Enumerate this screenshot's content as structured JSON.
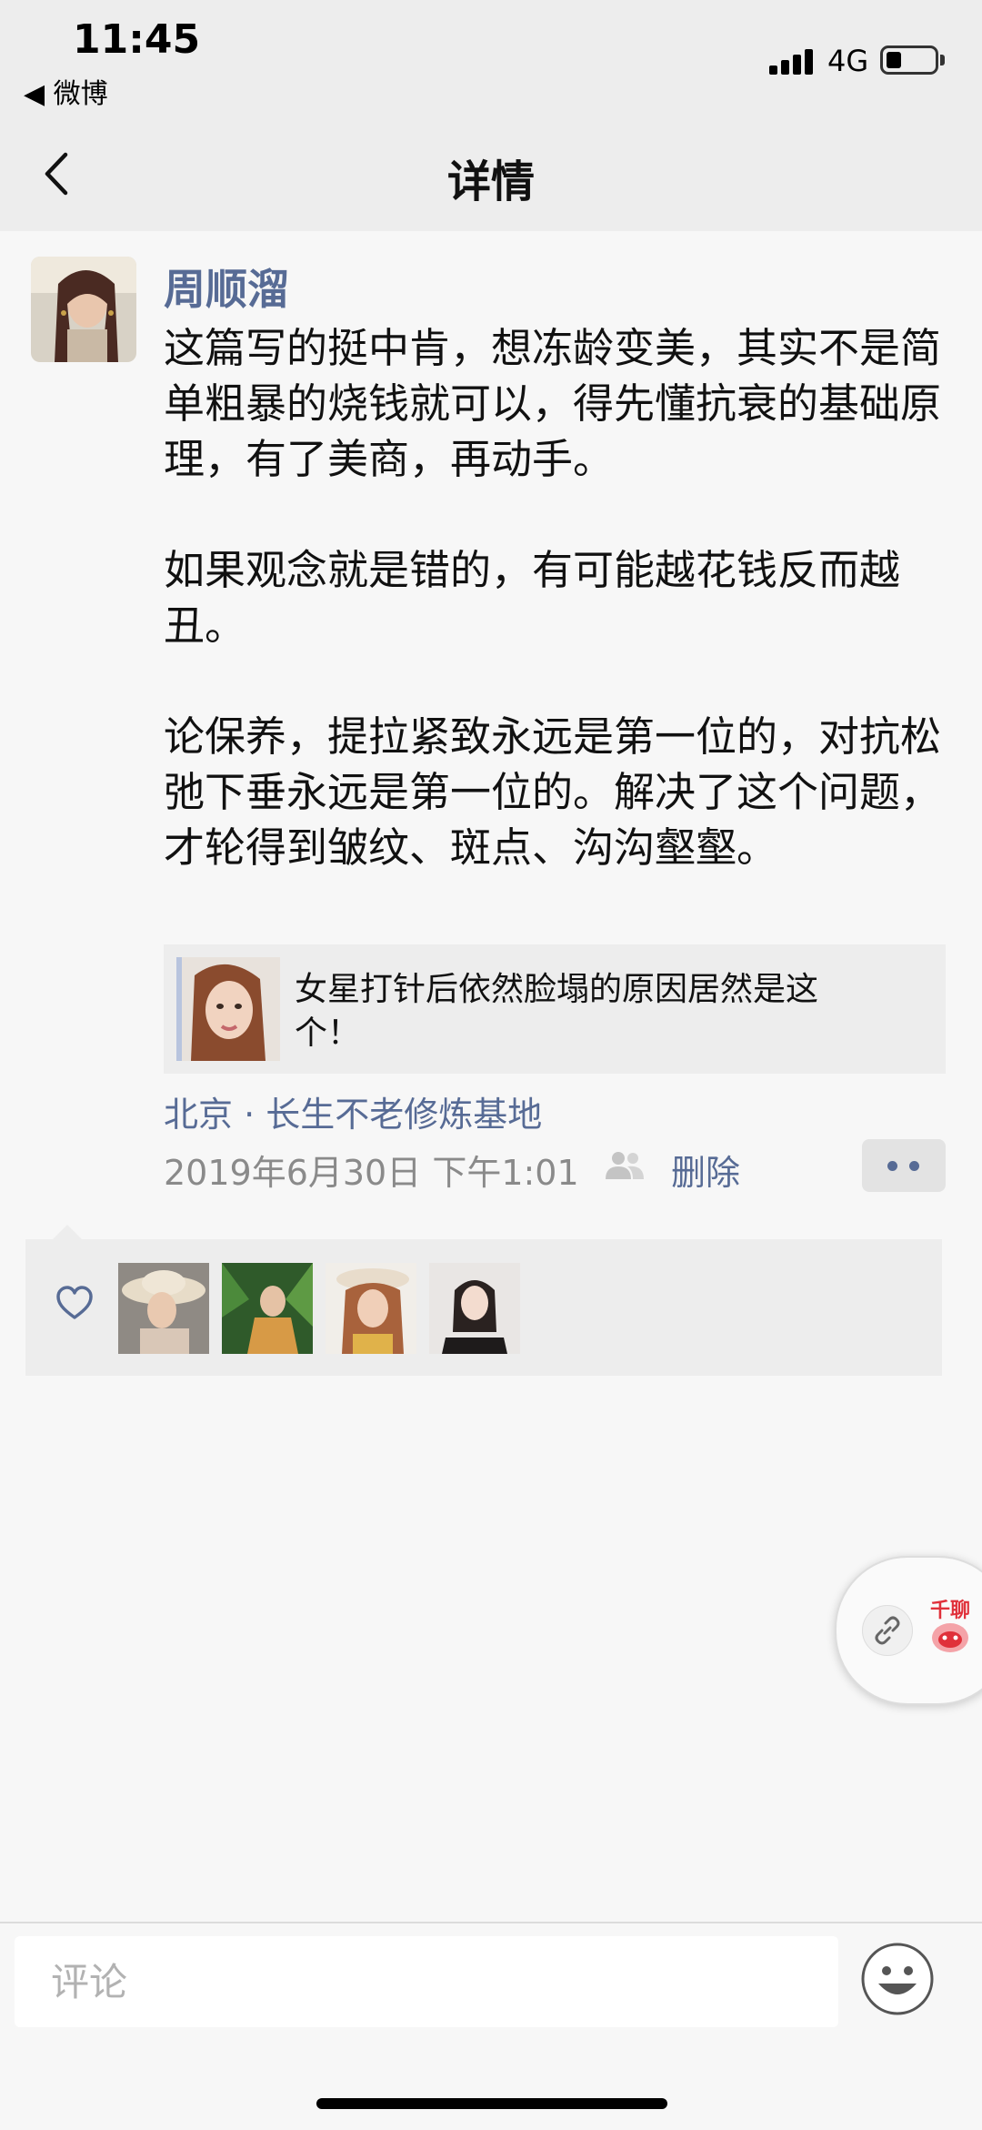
{
  "status_bar": {
    "time": "11:45",
    "back_app": "◀ 微博",
    "network": "4G",
    "battery_level": 0.3
  },
  "nav": {
    "title": "详情",
    "back_icon": "chevron-left-icon"
  },
  "post": {
    "author": "周顺溜",
    "text": "这篇写的挺中肯，想冻龄变美，其实不是简单粗暴的烧钱就可以，得先懂抗衰的基础原理，有了美商，再动手。\n\n如果观念就是错的，有可能越花钱反而越丑。\n\n论保养，提拉紧致永远是第一位的，对抗松弛下垂永远是第一位的。解决了这个问题，才轮得到皱纹、斑点、沟沟壑壑。",
    "link_card": {
      "title": "女星打针后依然脸塌的原因居然是这个！"
    },
    "location": "北京 · 长生不老修炼基地",
    "time": "2019年6月30日 下午1:01",
    "delete_label": "删除",
    "more_icon": "more-dots-icon"
  },
  "likes": {
    "icon": "heart-icon",
    "count": 4
  },
  "float_widget": {
    "app_label": "千聊"
  },
  "bottom_bar": {
    "comment_placeholder": "评论",
    "emoji_icon": "emoji-smile-icon"
  },
  "colors": {
    "link_blue": "#576b95",
    "nav_bg": "#ededed",
    "page_bg": "#f7f7f7",
    "meta_gray": "#8a8a8a"
  }
}
